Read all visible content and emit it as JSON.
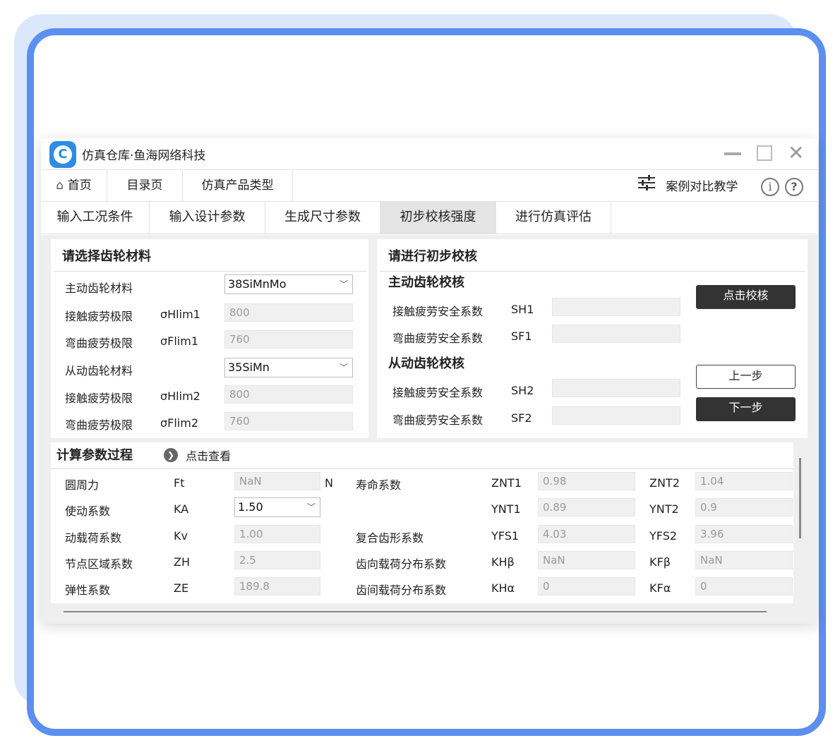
{
  "app": {
    "title": "仿真仓库·鱼海网络科技"
  },
  "nav": {
    "home": "首页",
    "catalog": "目录页",
    "product_types": "仿真产品类型",
    "case_compare": "案例对比教学"
  },
  "tabs": [
    "输入工况条件",
    "输入设计参数",
    "生成尺寸参数",
    "初步校核强度",
    "进行仿真评估"
  ],
  "material": {
    "title": "请选择齿轮材料",
    "driving_label": "主动齿轮材料",
    "driving_value": "38SiMnMo",
    "contact1_label": "接触疲劳极限",
    "contact1_sym": "σHlim1",
    "contact1_value": "800",
    "bend1_label": "弯曲疲劳极限",
    "bend1_sym": "σFlim1",
    "bend1_value": "760",
    "driven_label": "从动齿轮材料",
    "driven_value": "35SiMn",
    "contact2_label": "接触疲劳极限",
    "contact2_sym": "σHlim2",
    "contact2_value": "800",
    "bend2_label": "弯曲疲劳极限",
    "bend2_sym": "σFlim2",
    "bend2_value": "760"
  },
  "check": {
    "title": "请进行初步校核",
    "driving_title": "主动齿轮校核",
    "sh1_label": "接触疲劳安全系数",
    "sh1_sym": "SH1",
    "sf1_label": "弯曲疲劳安全系数",
    "sf1_sym": "SF1",
    "driven_title": "从动齿轮校核",
    "sh2_label": "接触疲劳安全系数",
    "sh2_sym": "SH2",
    "sf2_label": "弯曲疲劳安全系数",
    "sf2_sym": "SF2",
    "check_button": "点击校核",
    "prev_button": "上一步",
    "next_button": "下一步"
  },
  "calc": {
    "title": "计算参数过程",
    "view_label": "点击查看",
    "rows": [
      {
        "label": "圆周力",
        "sym": "Ft",
        "value": "NaN",
        "unit": "N",
        "label2": "寿命系数",
        "sym2": "ZNT1",
        "value2": "0.98",
        "sym3": "ZNT2",
        "value3": "1.04"
      },
      {
        "label": "使动系数",
        "sym": "KA",
        "value": "1.50",
        "unit": "",
        "label2": "",
        "sym2": "YNT1",
        "value2": "0.89",
        "sym3": "YNT2",
        "value3": "0.9"
      },
      {
        "label": "动载荷系数",
        "sym": "Kv",
        "value": "1.00",
        "unit": "",
        "label2": "复合齿形系数",
        "sym2": "YFS1",
        "value2": "4.03",
        "sym3": "YFS2",
        "value3": "3.96"
      },
      {
        "label": "节点区域系数",
        "sym": "ZH",
        "value": "2.5",
        "unit": "",
        "label2": "齿向载荷分布系数",
        "sym2": "KHβ",
        "value2": "NaN",
        "sym3": "KFβ",
        "value3": "NaN"
      },
      {
        "label": "弹性系数",
        "sym": "ZE",
        "value": "189.8",
        "unit": "",
        "label2": "齿间载荷分布系数",
        "sym2": "KHα",
        "value2": "0",
        "sym3": "KFα",
        "value3": "0"
      }
    ]
  }
}
